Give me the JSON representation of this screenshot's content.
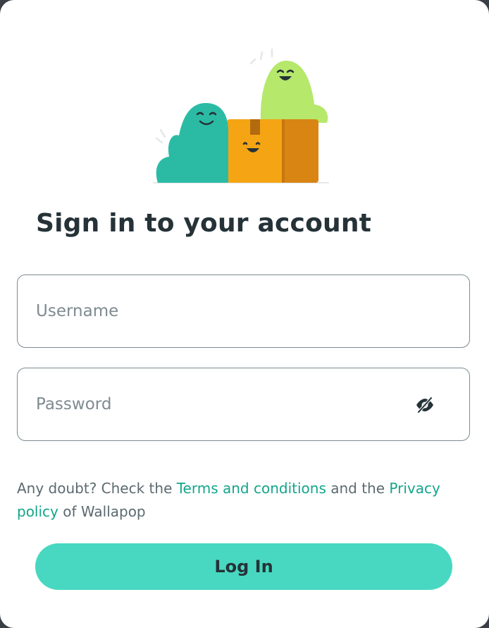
{
  "login": {
    "title": "Sign in to your account",
    "username": {
      "value": "",
      "placeholder": "Username"
    },
    "password": {
      "value": "",
      "placeholder": "Password"
    },
    "password_toggle_icon": "eye-slash-icon",
    "terms": {
      "prefix": "Any doubt? Check the ",
      "terms_link": "Terms and conditions",
      "middle": " and the ",
      "privacy_link": "Privacy policy",
      "suffix": " of Wallapop"
    },
    "submit_label": "Log In"
  },
  "colors": {
    "accent": "#48d8c1",
    "link": "#13a58a",
    "title_text": "#253238",
    "mascot_teal": "#2bbba5",
    "mascot_lime": "#b5e86b",
    "box_orange": "#f5a514"
  }
}
